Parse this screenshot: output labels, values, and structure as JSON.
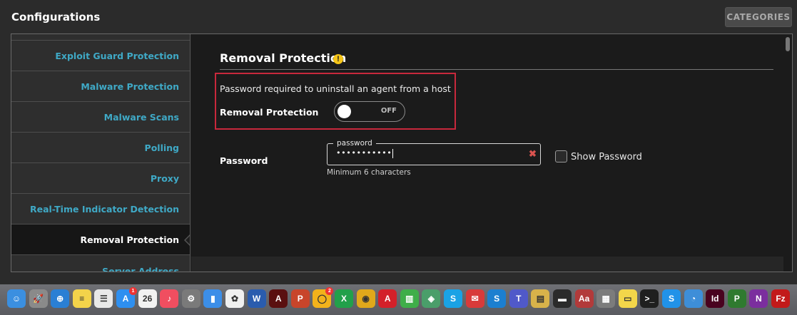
{
  "header": {
    "title": "Configurations",
    "categories_label": "CATEGORIES"
  },
  "sidebar": {
    "items": [
      {
        "label": "Exploit Guard Protection"
      },
      {
        "label": "Malware Protection"
      },
      {
        "label": "Malware Scans"
      },
      {
        "label": "Polling"
      },
      {
        "label": "Proxy"
      },
      {
        "label": "Real-Time Indicator Detection"
      },
      {
        "label": "Removal Protection",
        "active": true
      },
      {
        "label": "Server Address"
      }
    ]
  },
  "main": {
    "section_title": "Removal Protection",
    "warning_glyph": "!",
    "description": "Password required to uninstall an agent from a host",
    "removal_protection_label": "Removal Protection",
    "toggle_state": "OFF",
    "password_label": "Password",
    "password_float_label": "password",
    "password_value": "•••••••••••",
    "password_clear_glyph": "✖",
    "password_hint": "Minimum 6 characters",
    "show_password_label": "Show Password",
    "show_password_checked": false
  },
  "dock": {
    "icons": [
      {
        "name": "finder-icon",
        "glyph": "☺",
        "color": "#3b8fe0"
      },
      {
        "name": "launchpad-icon",
        "glyph": "🚀",
        "color": "#8a8a8a"
      },
      {
        "name": "safari-icon",
        "glyph": "⊕",
        "color": "#2a7fd4"
      },
      {
        "name": "notes-icon",
        "glyph": "≡",
        "color": "#f3d34a"
      },
      {
        "name": "reminders-icon",
        "glyph": "☰",
        "color": "#e8e8e8"
      },
      {
        "name": "app-store-icon",
        "glyph": "A",
        "color": "#2e8ff0",
        "badge": "1"
      },
      {
        "name": "calendar-icon",
        "glyph": "26",
        "color": "#f2f2f2"
      },
      {
        "name": "music-icon",
        "glyph": "♪",
        "color": "#f04e60"
      },
      {
        "name": "system-preferences-icon",
        "glyph": "⚙",
        "color": "#7a7a7a"
      },
      {
        "name": "keynote-icon",
        "glyph": "▮",
        "color": "#3c8ee8"
      },
      {
        "name": "photos-icon",
        "glyph": "✿",
        "color": "#f0f0f0"
      },
      {
        "name": "word-icon",
        "glyph": "W",
        "color": "#2a5cae"
      },
      {
        "name": "acrobat-icon",
        "glyph": "A",
        "color": "#5a1010"
      },
      {
        "name": "powerpoint-icon",
        "glyph": "P",
        "color": "#c8452b"
      },
      {
        "name": "ring-icon",
        "glyph": "◯",
        "color": "#f2b21b",
        "badge": "2"
      },
      {
        "name": "excel-x-icon",
        "glyph": "X",
        "color": "#22a04a"
      },
      {
        "name": "chrome-icon",
        "glyph": "◉",
        "color": "#e0a81b"
      },
      {
        "name": "acrobat-reader-icon",
        "glyph": "A",
        "color": "#d3202a"
      },
      {
        "name": "numbers-icon",
        "glyph": "▥",
        "color": "#3fae49"
      },
      {
        "name": "network-icon",
        "glyph": "◈",
        "color": "#4a9e6a"
      },
      {
        "name": "skype-icon",
        "glyph": "S",
        "color": "#1aa2e5"
      },
      {
        "name": "mail-app-icon",
        "glyph": "✉",
        "color": "#d83a3a"
      },
      {
        "name": "skype-business-icon",
        "glyph": "S",
        "color": "#1c7fd0"
      },
      {
        "name": "teams-icon",
        "glyph": "T",
        "color": "#5059c9"
      },
      {
        "name": "database-icon",
        "glyph": "▤",
        "color": "#d8b24a"
      },
      {
        "name": "terminal-icon",
        "glyph": "▬",
        "color": "#2b2b2b"
      },
      {
        "name": "dictionary-icon",
        "glyph": "Aa",
        "color": "#b23a3a"
      },
      {
        "name": "calculator-icon",
        "glyph": "▦",
        "color": "#7c7c7c"
      },
      {
        "name": "stickies-icon",
        "glyph": "▭",
        "color": "#f3d64a"
      },
      {
        "name": "console-icon",
        "glyph": ">_",
        "color": "#1f1f1f"
      },
      {
        "name": "skype-blue-icon",
        "glyph": "S",
        "color": "#2192e8"
      },
      {
        "name": "chat-icon",
        "glyph": "◔",
        "color": "#3e8ed8"
      },
      {
        "name": "indesign-icon",
        "glyph": "Id",
        "color": "#49021f"
      },
      {
        "name": "project-icon",
        "glyph": "P",
        "color": "#2f7a2f"
      },
      {
        "name": "onenote-icon",
        "glyph": "N",
        "color": "#7b2e9e"
      },
      {
        "name": "filezilla-icon",
        "glyph": "Fz",
        "color": "#c21a1a"
      }
    ]
  }
}
